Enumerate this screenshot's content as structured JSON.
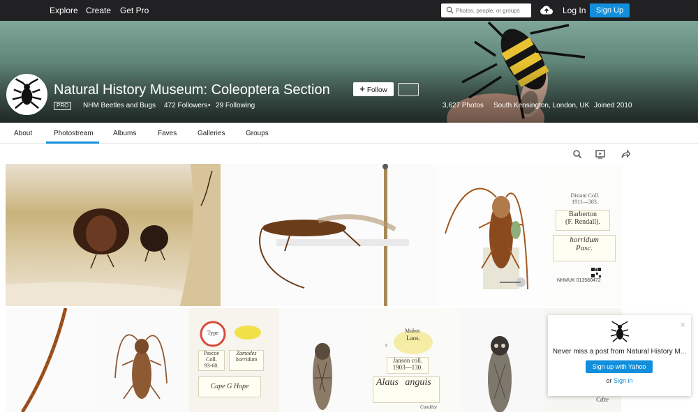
{
  "topnav": {
    "explore": "Explore",
    "create": "Create",
    "get_pro": "Get Pro",
    "search_placeholder": "Photos, people, or groups",
    "login": "Log In",
    "signup": "Sign Up"
  },
  "profile": {
    "title": "Natural History Museum: Coleoptera Section",
    "follow": "Follow",
    "pro": "PRO",
    "username": "NHM Beetles and Bugs",
    "followers": "472 Followers",
    "separator": "•",
    "following": "29 Following",
    "photos": "3,627 Photos",
    "location": "South Kensington, London, UK",
    "joined": "Joined 2010"
  },
  "tabs": [
    "About",
    "Photostream",
    "Albums",
    "Faves",
    "Galleries",
    "Groups"
  ],
  "active_tab": "Photostream",
  "labels": {
    "p4": [
      "Distant Coll.",
      "1911—383.",
      "Barberton",
      "(F. Rendall).",
      "horridum",
      "Pasc.",
      "NHMUK 013580472"
    ],
    "p7": [
      "Type",
      "Pascoe Coll.",
      "93-60.",
      "Zamodes horridum",
      "Cape G Hope"
    ],
    "p9": [
      "Muhot",
      "Laos.",
      "♀",
      "Janson coll.",
      "1903—130.",
      "Alaus",
      "anguis",
      "Candèze"
    ],
    "p11": [
      "Cdze"
    ]
  },
  "popup": {
    "close": "×",
    "text": "Never miss a post from Natural History M...",
    "button": "Sign up with Yahoo",
    "or": "or",
    "signin": "Sign in"
  },
  "colors": {
    "nav_bg": "#212124",
    "accent": "#128fdc"
  }
}
